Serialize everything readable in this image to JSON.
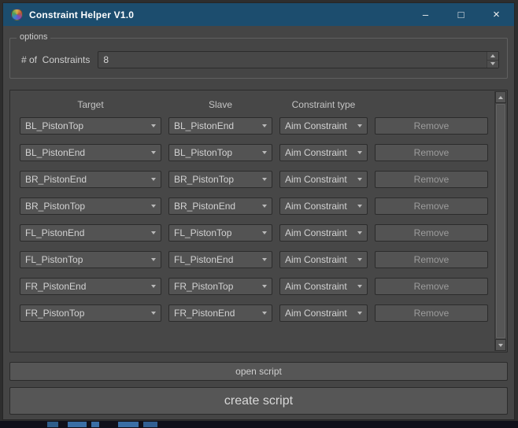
{
  "window": {
    "title": "Constraint Helper V1.0",
    "minimize": "–",
    "maximize": "□",
    "close": "×"
  },
  "colors": {
    "titlebar": "#1c4d6e",
    "background": "#454545",
    "control": "#535353"
  },
  "options": {
    "label": "options",
    "field_label": "# of  Constraints",
    "value": "8"
  },
  "table": {
    "headers": {
      "target": "Target",
      "slave": "Slave",
      "type": "Constraint type"
    },
    "remove_label": "Remove",
    "rows": [
      {
        "target": "BL_PistonTop",
        "slave": "BL_PistonEnd",
        "type": "Aim Constraint"
      },
      {
        "target": "BL_PistonEnd",
        "slave": "BL_PistonTop",
        "type": "Aim Constraint"
      },
      {
        "target": "BR_PistonEnd",
        "slave": "BR_PistonTop",
        "type": "Aim Constraint"
      },
      {
        "target": "BR_PistonTop",
        "slave": "BR_PistonEnd",
        "type": "Aim Constraint"
      },
      {
        "target": "FL_PistonEnd",
        "slave": "FL_PistonTop",
        "type": "Aim Constraint"
      },
      {
        "target": "FL_PistonTop",
        "slave": "FL_PistonEnd",
        "type": "Aim Constraint"
      },
      {
        "target": "FR_PistonEnd",
        "slave": "FR_PistonTop",
        "type": "Aim Constraint"
      },
      {
        "target": "FR_PistonTop",
        "slave": "FR_PistonEnd",
        "type": "Aim Constraint"
      }
    ]
  },
  "footer": {
    "open": "open script",
    "create": "create script"
  }
}
